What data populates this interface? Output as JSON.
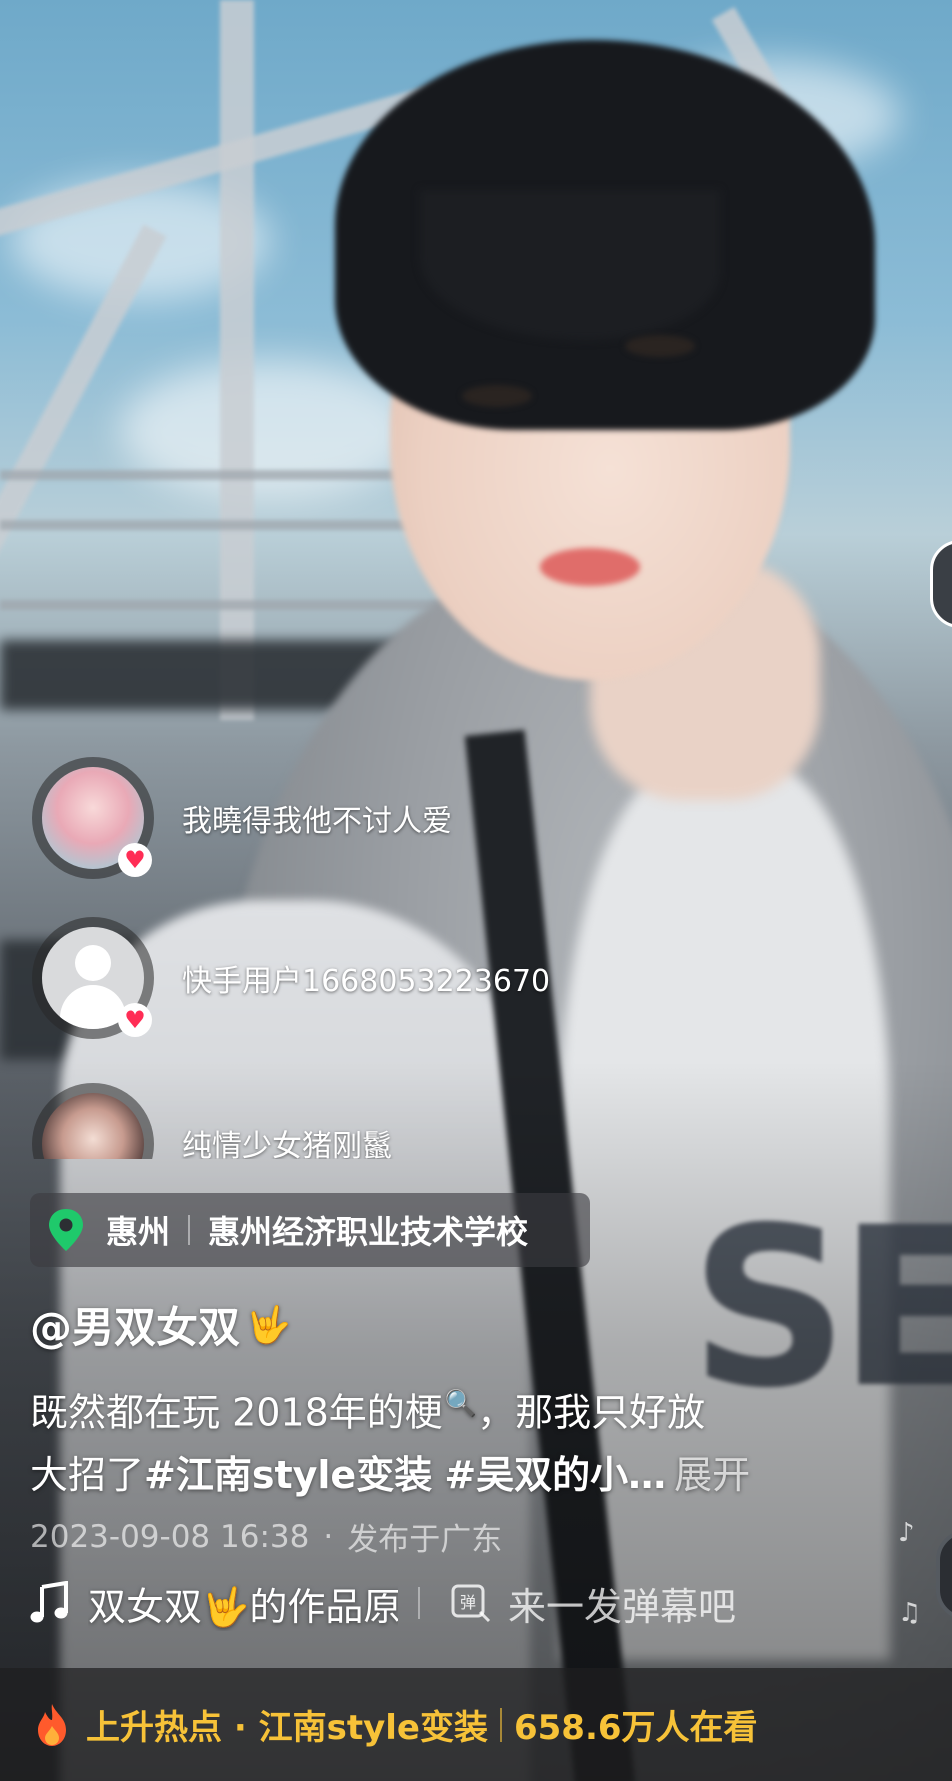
{
  "viewers": [
    {
      "name": "我曉得我他不讨人爱",
      "badge": "♥"
    },
    {
      "name": "快手用户1668053223670",
      "badge": "♥"
    },
    {
      "name": "纯情少女猪刚鬣"
    }
  ],
  "location": {
    "city": "惠州",
    "place": "惠州经济职业技术学校"
  },
  "author": {
    "handle": "@男双女双",
    "emoji": "🤟"
  },
  "caption": {
    "text_1": "既然都在玩 2018年的梗",
    "search_mark": "🔍",
    "text_2": "，那我只好放",
    "text_3": "大招了",
    "hashtag_1": "#江南style变装",
    "hashtag_2": "#吴双的小…",
    "expand": "展开"
  },
  "meta": {
    "datetime": "2023-09-08 16:38",
    "dot": "·",
    "published_in": "发布于广东"
  },
  "music": {
    "title": "双女双🤟的作品原声",
    "icon": "music-note-icon"
  },
  "danmaku": {
    "placeholder": "来一发弹幕吧",
    "icon": "danmaku-icon"
  },
  "hot": {
    "label": "上升热点 · 江南style变装",
    "viewers": "658.6万人在看",
    "icon": "fire-icon"
  },
  "colors": {
    "hot_accent": "#f7c238",
    "heart": "#ff2d55",
    "pin": "#1fc96b"
  }
}
